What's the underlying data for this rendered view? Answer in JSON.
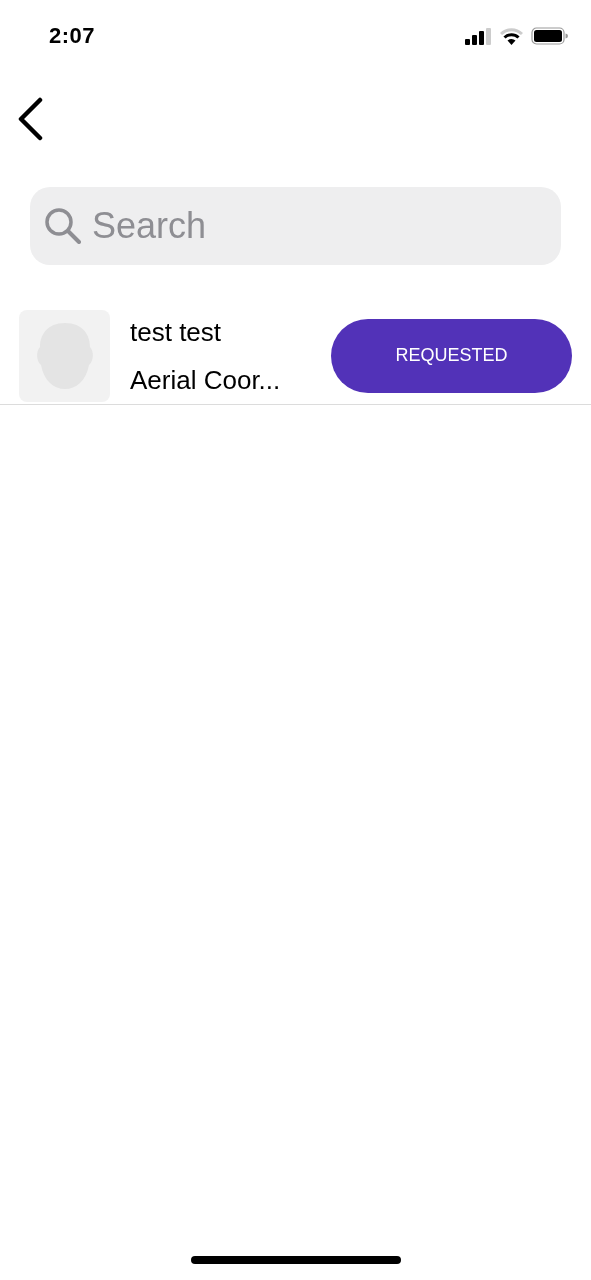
{
  "status_bar": {
    "time": "2:07"
  },
  "search": {
    "placeholder": "Search"
  },
  "results": [
    {
      "name": "test test",
      "subtitle": "Aerial Coor...",
      "action": "REQUESTED"
    }
  ]
}
